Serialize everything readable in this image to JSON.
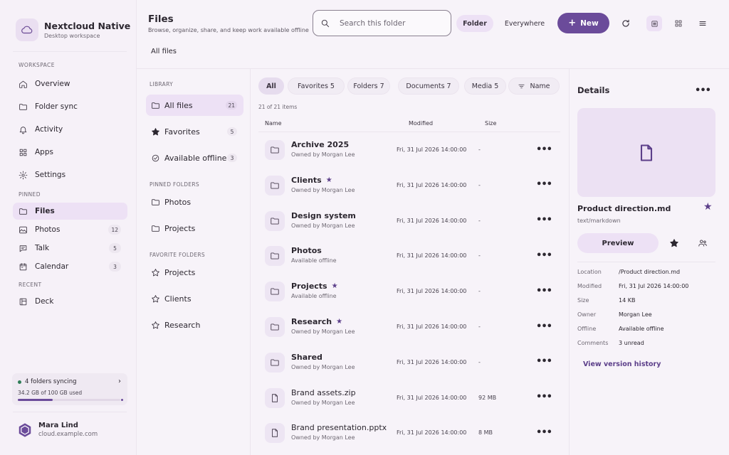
{
  "app": {
    "name": "Nextcloud Native",
    "subtitle": "Desktop workspace"
  },
  "sidebar": {
    "sections": {
      "workspace": "WORKSPACE",
      "pinned": "PINNED",
      "recent": "RECENT"
    },
    "workspace_items": [
      {
        "label": "Overview",
        "icon": "house-icon"
      },
      {
        "label": "Folder sync",
        "icon": "folder-icon"
      },
      {
        "label": "Activity",
        "icon": "bell-icon"
      },
      {
        "label": "Apps",
        "icon": "grid-icon"
      },
      {
        "label": "Settings",
        "icon": "gear-icon"
      }
    ],
    "pinned_items": [
      {
        "label": "Files",
        "icon": "folder-icon",
        "active": true
      },
      {
        "label": "Photos",
        "icon": "image-icon",
        "badge": "12"
      },
      {
        "label": "Talk",
        "icon": "chat-icon",
        "badge": "5"
      },
      {
        "label": "Calendar",
        "icon": "calendar-icon",
        "badge": "3"
      }
    ],
    "recent_items": [
      {
        "label": "Deck",
        "icon": "board-icon"
      }
    ],
    "sync": {
      "status": "4 folders syncing",
      "usage": "34.2 GB of 100 GB used",
      "used_fraction": 0.342,
      "status_color": "#2f7d57"
    },
    "user": {
      "name": "Mara Lind",
      "host": "cloud.example.com"
    }
  },
  "header": {
    "title": "Files",
    "subtitle": "Browse, organize, share, and keep work available offline",
    "search_placeholder": "Search this folder",
    "scope": {
      "folder": "Folder",
      "everywhere": "Everywhere",
      "selected": "Folder"
    },
    "new_label": "New",
    "breadcrumb": "All files",
    "view": "list"
  },
  "library": {
    "sections": {
      "library": "LIBRARY",
      "pinned": "PINNED FOLDERS",
      "favorites": "FAVORITE FOLDERS"
    },
    "items": [
      {
        "label": "All files",
        "badge": "21",
        "icon": "folder-icon",
        "active": true
      },
      {
        "label": "Favorites",
        "badge": "5",
        "icon": "star-icon"
      },
      {
        "label": "Available offline",
        "badge": "3",
        "icon": "check-circle-icon"
      }
    ],
    "pinned_folders": [
      {
        "label": "Photos",
        "icon": "folder-icon"
      },
      {
        "label": "Projects",
        "icon": "folder-icon"
      }
    ],
    "favorite_folders": [
      {
        "label": "Projects",
        "icon": "star-outline-icon"
      },
      {
        "label": "Clients",
        "icon": "star-outline-icon"
      },
      {
        "label": "Research",
        "icon": "star-outline-icon"
      }
    ]
  },
  "filters": {
    "chips": [
      {
        "label": "All",
        "active": true
      },
      {
        "label": "Favorites 5"
      },
      {
        "label": "Folders 7"
      },
      {
        "label": "Documents 7"
      },
      {
        "label": "Media 5"
      }
    ],
    "sort_label": "Name"
  },
  "list": {
    "count": "21 of 21 items",
    "columns": {
      "name": "Name",
      "modified": "Modified",
      "size": "Size"
    },
    "rows": [
      {
        "name": "Archive 2025",
        "sub": "Owned by Morgan Lee",
        "modified": "Fri, 31 Jul 2026 14:00:00",
        "size": "-",
        "type": "folder",
        "starred": false
      },
      {
        "name": "Clients",
        "sub": "Owned by Morgan Lee",
        "modified": "Fri, 31 Jul 2026 14:00:00",
        "size": "-",
        "type": "folder",
        "starred": true
      },
      {
        "name": "Design system",
        "sub": "Owned by Morgan Lee",
        "modified": "Fri, 31 Jul 2026 14:00:00",
        "size": "-",
        "type": "folder",
        "starred": false
      },
      {
        "name": "Photos",
        "sub": "Available offline",
        "modified": "Fri, 31 Jul 2026 14:00:00",
        "size": "-",
        "type": "folder",
        "starred": false
      },
      {
        "name": "Projects",
        "sub": "Available offline",
        "modified": "Fri, 31 Jul 2026 14:00:00",
        "size": "-",
        "type": "folder",
        "starred": true
      },
      {
        "name": "Research",
        "sub": "Owned by Morgan Lee",
        "modified": "Fri, 31 Jul 2026 14:00:00",
        "size": "-",
        "type": "folder",
        "starred": true
      },
      {
        "name": "Shared",
        "sub": "Owned by Morgan Lee",
        "modified": "Fri, 31 Jul 2026 14:00:00",
        "size": "-",
        "type": "folder",
        "starred": false
      },
      {
        "name": "Brand assets.zip",
        "sub": "Owned by Morgan Lee",
        "modified": "Fri, 31 Jul 2026 14:00:00",
        "size": "92 MB",
        "type": "file",
        "starred": false
      },
      {
        "name": "Brand presentation.pptx",
        "sub": "Owned by Morgan Lee",
        "modified": "Fri, 31 Jul 2026 14:00:00",
        "size": "8 MB",
        "type": "file",
        "starred": false
      }
    ]
  },
  "details": {
    "title": "Details",
    "file_name": "Product direction.md",
    "mime": "text/markdown",
    "preview_label": "Preview",
    "meta": [
      {
        "key": "Location",
        "value": "/Product direction.md"
      },
      {
        "key": "Modified",
        "value": "Fri, 31 Jul 2026 14:00:00"
      },
      {
        "key": "Size",
        "value": "14 KB"
      },
      {
        "key": "Owner",
        "value": "Morgan Lee"
      },
      {
        "key": "Offline",
        "value": "Available offline"
      },
      {
        "key": "Comments",
        "value": "3 unread"
      }
    ],
    "version_link": "View version history"
  },
  "colors": {
    "accent": "#6b4b9a",
    "accent_soft": "#ede1f5",
    "star": "#5c3f8a"
  }
}
